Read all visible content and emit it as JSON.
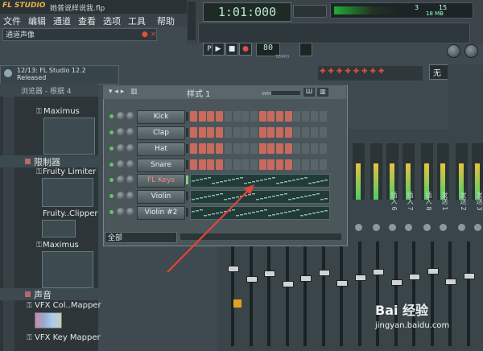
{
  "app": {
    "logo_text": "FL STUDIO",
    "file_name": "她普说样说我.flp",
    "menu": [
      "文件",
      "编辑",
      "通道",
      "查看",
      "选项",
      "工具",
      "帮助"
    ],
    "hint_text": "通道声像"
  },
  "transport": {
    "time": "1:01:000",
    "bpm": "80",
    "bpm_label": "TEMPO",
    "cpu": {
      "voices": "3",
      "cpu_value": "15",
      "memory": "18 MB"
    },
    "snap_value": "无"
  },
  "news": {
    "line1": "12/13: FL Studio 12.2",
    "line2": "Released"
  },
  "browser": {
    "title": "浏览器 - 根据 4",
    "items": [
      {
        "label": "Maximus",
        "type": "plugin"
      },
      {
        "label": "限制器",
        "type": "section"
      },
      {
        "label": "Fruity Limiter",
        "type": "plugin"
      },
      {
        "label": "Fruity..Clipper",
        "type": "plugin"
      },
      {
        "label": "Maximus",
        "type": "plugin"
      },
      {
        "label": "声音",
        "type": "section"
      },
      {
        "label": "VFX Col..Mapper",
        "type": "plugin"
      },
      {
        "label": "VFX Key Mapper",
        "type": "plugin"
      }
    ]
  },
  "channel_rack": {
    "title": "样式 1",
    "swing_label": "SWING",
    "filter": "全部",
    "channels": [
      {
        "name": "Kick",
        "mode": "steps",
        "selected": false
      },
      {
        "name": "Clap",
        "mode": "steps",
        "selected": false
      },
      {
        "name": "Hat",
        "mode": "steps",
        "selected": false
      },
      {
        "name": "Snare",
        "mode": "steps",
        "selected": false
      },
      {
        "name": "FL Keys",
        "mode": "pianoroll",
        "selected": true
      },
      {
        "name": "Violin",
        "mode": "pianoroll",
        "selected": false
      },
      {
        "name": "Violin #2",
        "mode": "pianoroll",
        "selected": false
      }
    ]
  },
  "mixer": {
    "insert_labels": [
      "插入 6",
      "插入 7",
      "插入 8",
      "发送 1",
      "发送 2",
      "发送 3"
    ]
  },
  "watermark": {
    "text": "Bai 经验",
    "url": "jingyan.baidu.com"
  },
  "colors": {
    "accent_orange": "#e8b24a",
    "step_red": "#c86a5e",
    "led_green": "#5ec95e",
    "annotation_arrow": "#e0453a"
  }
}
